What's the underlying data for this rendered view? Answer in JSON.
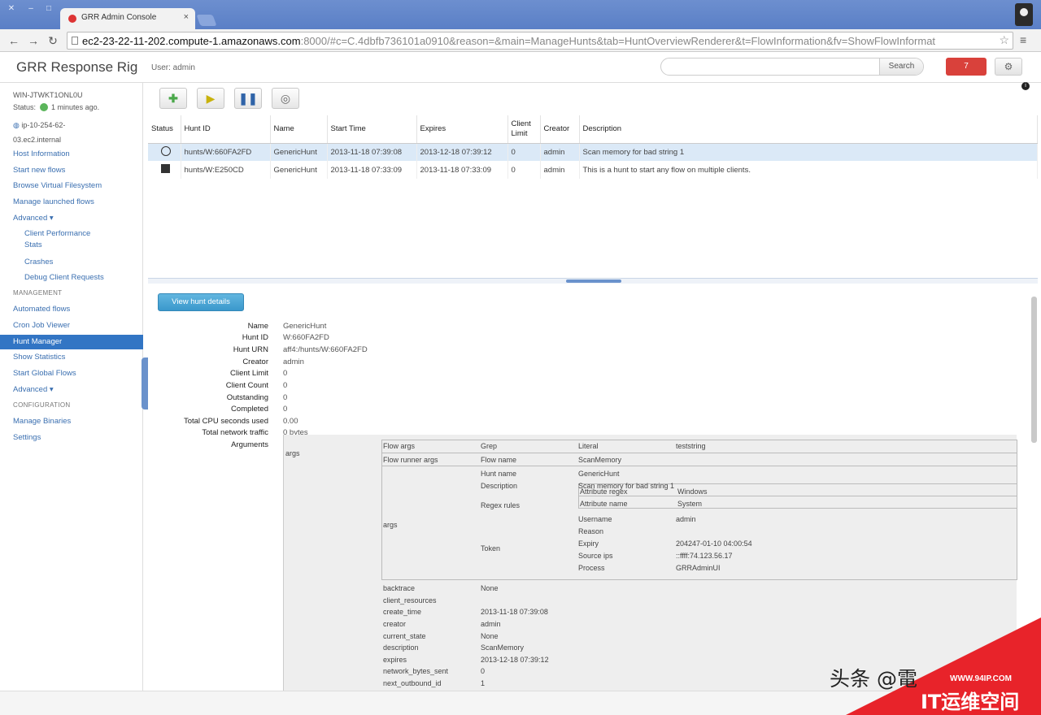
{
  "browser": {
    "tab_title": "GRR Admin Console",
    "url_host": "ec2-23-22-11-202.compute-1.amazonaws.com",
    "url_rest": ":8000/#c=C.4dbfb736101a0910&reason=&main=ManageHunts&tab=HuntOverviewRenderer&t=FlowInformation&fv=ShowFlowInformat"
  },
  "header": {
    "brand": "GRR Response Rig",
    "user": "User: admin",
    "search_button": "Search",
    "notifications": "7"
  },
  "sidebar": {
    "client_name": "WIN-JTWKT1ONL0U",
    "client_status_label": "Status:",
    "client_status_time": "1 minutes ago.",
    "client_host_1": "ip-10-254-62-",
    "client_host_2": "03.ec2.internal",
    "links": [
      "Host Information",
      "Start new flows",
      "Browse Virtual Filesystem",
      "Manage launched flows",
      "Advanced ▾"
    ],
    "sublinks": [
      "Client Performance",
      "Stats",
      "Crashes",
      "Debug Client Requests"
    ],
    "management_head": "MANAGEMENT",
    "management": [
      "Automated flows",
      "Cron Job Viewer",
      "Hunt Manager",
      "Show Statistics",
      "Start Global Flows",
      "Advanced ▾"
    ],
    "config_head": "CONFIGURATION",
    "config": [
      "Manage Binaries",
      "Settings"
    ]
  },
  "hunts_table": {
    "headers": [
      "Status",
      "Hunt ID",
      "Name",
      "Start Time",
      "Expires",
      "Client Limit",
      "Creator",
      "Description"
    ],
    "rows": [
      {
        "status": "running",
        "id": "hunts/W:660FA2FD",
        "name": "GenericHunt",
        "start": "2013-11-18 07:39:08",
        "expires": "2013-12-18 07:39:12",
        "limit": "0",
        "creator": "admin",
        "desc": "Scan memory for bad string 1"
      },
      {
        "status": "stopped",
        "id": "hunts/W:E250CD",
        "name": "GenericHunt",
        "start": "2013-11-18 07:33:09",
        "expires": "2013-11-18 07:33:09",
        "limit": "0",
        "creator": "admin",
        "desc": "This is a hunt to start any flow on multiple clients."
      }
    ]
  },
  "details": {
    "view_button": "View hunt details",
    "fields": [
      {
        "k": "Name",
        "v": "GenericHunt"
      },
      {
        "k": "Hunt ID",
        "v": "W:660FA2FD"
      },
      {
        "k": "Hunt URN",
        "v": "aff4:/hunts/W:660FA2FD"
      },
      {
        "k": "Creator",
        "v": "admin"
      },
      {
        "k": "Client Limit",
        "v": "0"
      },
      {
        "k": "Client Count",
        "v": "0"
      },
      {
        "k": "Outstanding",
        "v": "0"
      },
      {
        "k": "Completed",
        "v": "0"
      },
      {
        "k": "Total CPU seconds used",
        "v": "0.00"
      },
      {
        "k": "Total network traffic",
        "v": "0 bytes"
      },
      {
        "k": "Arguments",
        "v": ""
      }
    ],
    "args": {
      "args_label": "args",
      "flow_args": "Flow args",
      "grep": "Grep",
      "literal": "Literal",
      "literal_val": "teststring",
      "flow_runner_args": "Flow runner args",
      "flow_name": "Flow name",
      "flow_name_val": "ScanMemory",
      "args2": "args",
      "hunt_name": "Hunt name",
      "hunt_name_val": "GenericHunt",
      "description": "Description",
      "description_val": "Scan memory for bad string 1",
      "regex_rules": "Regex rules",
      "attr_regex": "Attribute regex",
      "attr_regex_val": "Windows",
      "attr_name": "Attribute name",
      "attr_name_val": "System",
      "token": "Token",
      "username": "Username",
      "username_val": "admin",
      "reason": "Reason",
      "expiry": "Expiry",
      "expiry_val": "204247-01-10 04:00:54",
      "source_ips": "Source ips",
      "source_ips_val": "::ffff:74.123.56.17",
      "process": "Process",
      "process_val": "GRRAdminUI",
      "backtrace": "backtrace",
      "backtrace_val": "None",
      "client_resources": "client_resources",
      "create_time": "create_time",
      "create_time_val": "2013-11-18 07:39:08",
      "creator": "creator",
      "creator_val": "admin",
      "current_state": "current_state",
      "current_state_val": "None",
      "desc2": "description",
      "desc2_val": "ScanMemory",
      "expires": "expires",
      "expires_val": "2013-12-18 07:39:12",
      "network_bytes_sent": "network_bytes_sent",
      "network_bytes_sent_val": "0",
      "next_outbound_id": "next_outbound_id",
      "next_outbound_id_val": "1"
    }
  },
  "watermark": {
    "text": "头条 @電",
    "url": "WWW.94IP.COM",
    "brand": "IT运维空间"
  },
  "colors": {
    "accent": "#3275c4",
    "danger": "#d9413b",
    "link": "#3a6fb0"
  }
}
